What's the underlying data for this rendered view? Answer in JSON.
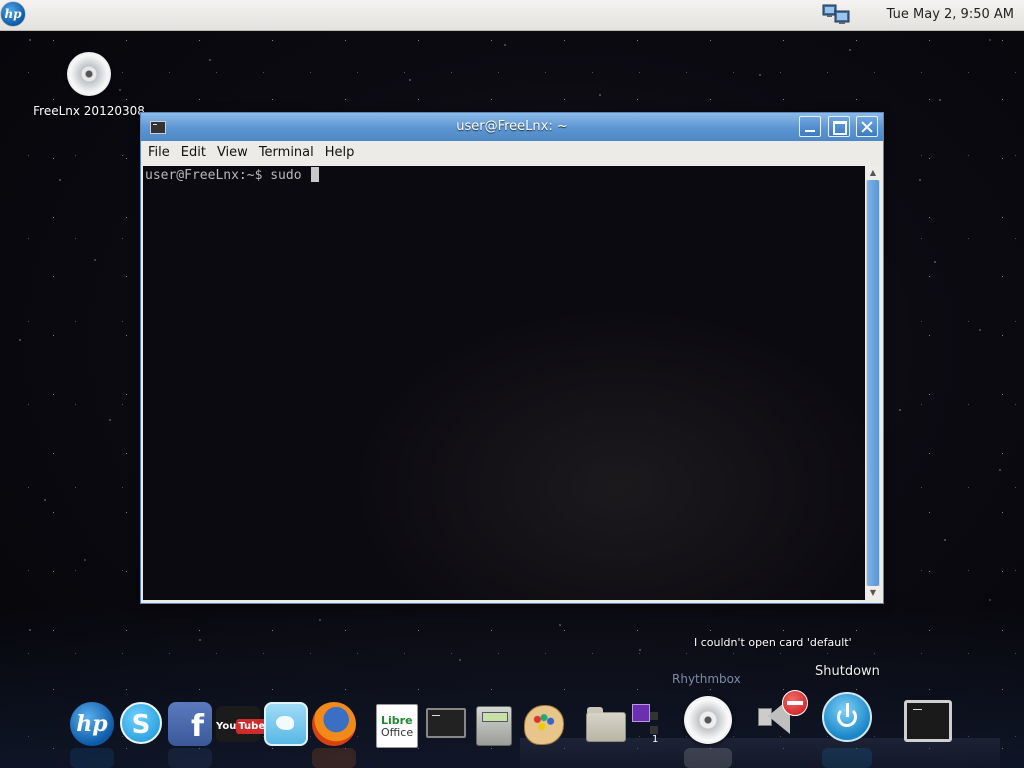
{
  "top_panel": {
    "clock": "Tue May  2,   9:50  AM",
    "menu_icon": "hp-logo-icon",
    "network_icon": "network-computers-icon"
  },
  "desktop": {
    "icons": [
      {
        "label": "FreeLnx 20120308",
        "icon": "cd-disc-icon"
      }
    ]
  },
  "terminal_window": {
    "title": "user@FreeLnx: ~",
    "menu": {
      "file": "File",
      "edit": "Edit",
      "view": "View",
      "terminal": "Terminal",
      "help": "Help"
    },
    "prompt": "user@FreeLnx:~$ ",
    "typed": "sudo "
  },
  "notifications": {
    "error": "I couldn't open card 'default'",
    "rhythmbox_tooltip": "Rhythmbox",
    "shutdown_tooltip": "Shutdown"
  },
  "dock": {
    "items": [
      {
        "name": "hp",
        "icon": "hp-logo-icon",
        "label": "hp"
      },
      {
        "name": "skype",
        "icon": "skype-icon",
        "label": "S"
      },
      {
        "name": "facebook",
        "icon": "facebook-icon",
        "label": "f"
      },
      {
        "name": "youtube",
        "icon": "youtube-icon",
        "label_a": "You",
        "label_b": "Tube"
      },
      {
        "name": "twitter",
        "icon": "twitter-icon"
      },
      {
        "name": "firefox",
        "icon": "firefox-icon"
      },
      {
        "name": "libreoffice",
        "icon": "libreoffice-icon",
        "label_a": "Libre",
        "label_b": "Office"
      },
      {
        "name": "terminal",
        "icon": "terminal-icon"
      },
      {
        "name": "calculator",
        "icon": "calculator-icon"
      },
      {
        "name": "paint",
        "icon": "paint-palette-icon"
      },
      {
        "name": "file-manager",
        "icon": "folder-icon"
      },
      {
        "name": "workspace-switcher",
        "icon": "workspace-switcher-icon",
        "label": "1"
      },
      {
        "name": "rhythmbox",
        "icon": "cd-disc-icon"
      },
      {
        "name": "volume",
        "icon": "volume-muted-icon"
      },
      {
        "name": "shutdown",
        "icon": "power-icon"
      },
      {
        "name": "terminal-2",
        "icon": "terminal-icon"
      }
    ]
  }
}
